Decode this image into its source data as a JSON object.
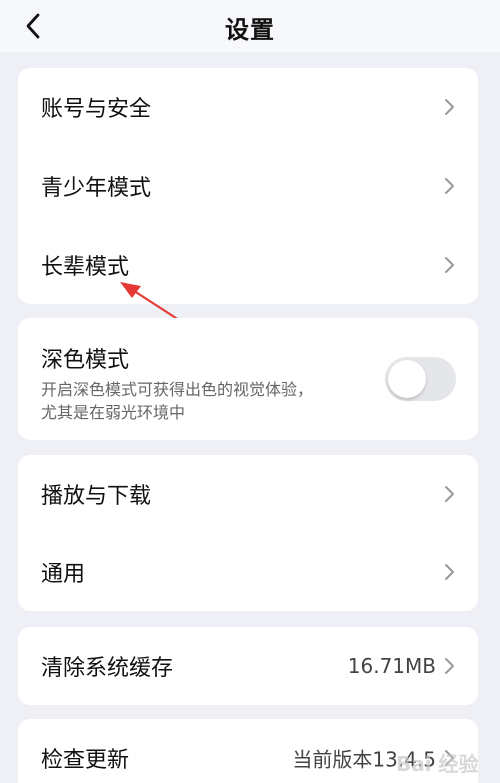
{
  "header": {
    "title": "设置",
    "back_icon": "chevron-left-icon"
  },
  "account_group": {
    "items": [
      {
        "label": "账号与安全"
      },
      {
        "label": "青少年模式"
      },
      {
        "label": "长辈模式"
      }
    ]
  },
  "dark_mode": {
    "title": "深色模式",
    "description_line1": "开启深色模式可获得出色的视觉体验，",
    "description_line2": "尤其是在弱光环境中",
    "enabled": false
  },
  "general_group": {
    "items": [
      {
        "label": "播放与下载"
      },
      {
        "label": "通用"
      }
    ]
  },
  "cache": {
    "label": "清除系统缓存",
    "value": "16.71MB"
  },
  "update": {
    "label": "检查更新",
    "value": "当前版本13.4.5"
  },
  "colors": {
    "page_background": "#eef0f6",
    "card_background": "#ffffff",
    "annotation_arrow": "#e53935"
  },
  "watermark": {
    "text": "Bai 经验"
  }
}
